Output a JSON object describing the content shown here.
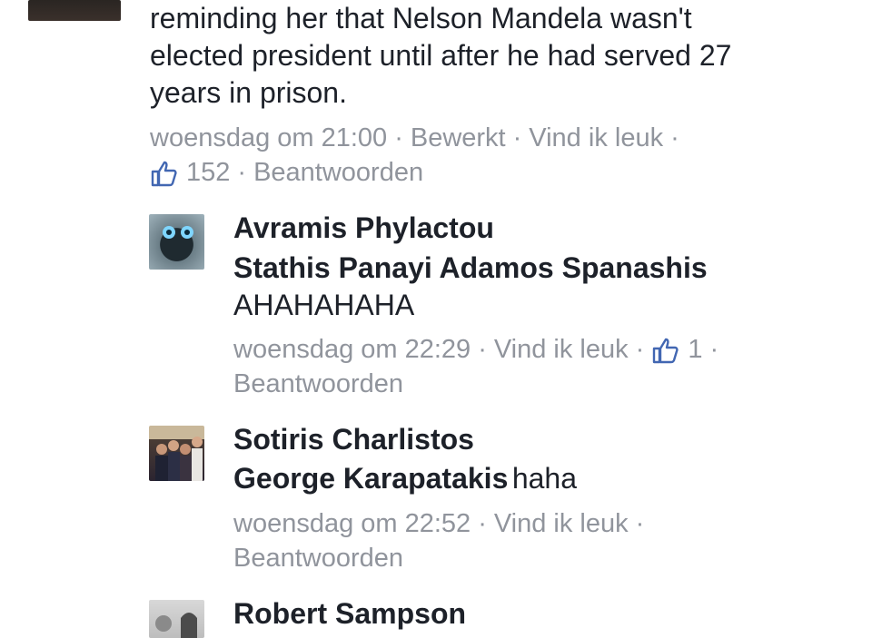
{
  "top_comment": {
    "text_lines": [
      "reminding her that Nelson Mandela wasn't",
      "elected president until after he had served 27",
      "years in prison."
    ],
    "time": "woensdag om 21:00",
    "edited": "Bewerkt",
    "like_label": "Vind ik leuk",
    "like_count": "152",
    "reply_label": "Beantwoorden"
  },
  "replies": [
    {
      "author": "Avramis Phylactou",
      "mention": "Stathis Panayi Adamos Spanashis",
      "text": "AHAHAHAHA",
      "time": "woensdag om 22:29",
      "like_label": "Vind ik leuk",
      "like_count": "1",
      "reply_label": "Beantwoorden"
    },
    {
      "author": "Sotiris Charlistos",
      "mention": "George Karapatakis",
      "text": "haha",
      "time": "woensdag om 22:52",
      "like_label": "Vind ik leuk",
      "reply_label": "Beantwoorden"
    },
    {
      "author": "Robert Sampson"
    }
  ],
  "separator": "·",
  "colors": {
    "text": "#1d2129",
    "meta": "#90949c",
    "like_icon": "#4267b2"
  }
}
